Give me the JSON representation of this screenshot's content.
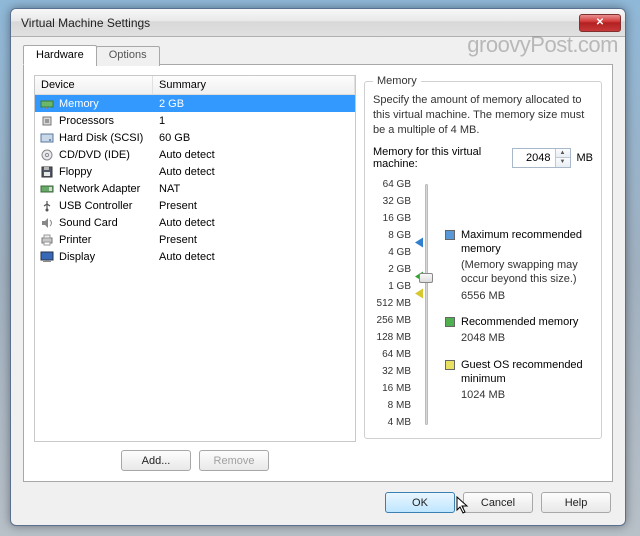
{
  "window": {
    "title": "Virtual Machine Settings"
  },
  "tabs": {
    "hardware": "Hardware",
    "options": "Options"
  },
  "list": {
    "head": {
      "device": "Device",
      "summary": "Summary"
    },
    "rows": [
      {
        "name": "Memory",
        "summary": "2 GB",
        "icon": "memory-icon",
        "selected": true
      },
      {
        "name": "Processors",
        "summary": "1",
        "icon": "cpu-icon"
      },
      {
        "name": "Hard Disk (SCSI)",
        "summary": "60 GB",
        "icon": "hdd-icon"
      },
      {
        "name": "CD/DVD (IDE)",
        "summary": "Auto detect",
        "icon": "cd-icon"
      },
      {
        "name": "Floppy",
        "summary": "Auto detect",
        "icon": "floppy-icon"
      },
      {
        "name": "Network Adapter",
        "summary": "NAT",
        "icon": "nic-icon"
      },
      {
        "name": "USB Controller",
        "summary": "Present",
        "icon": "usb-icon"
      },
      {
        "name": "Sound Card",
        "summary": "Auto detect",
        "icon": "sound-icon"
      },
      {
        "name": "Printer",
        "summary": "Present",
        "icon": "printer-icon"
      },
      {
        "name": "Display",
        "summary": "Auto detect",
        "icon": "display-icon"
      }
    ],
    "buttons": {
      "add": "Add...",
      "remove": "Remove"
    }
  },
  "memory": {
    "group_title": "Memory",
    "desc": "Specify the amount of memory allocated to this virtual machine. The memory size must be a multiple of 4 MB.",
    "label": "Memory for this virtual machine:",
    "value": "2048",
    "unit": "MB",
    "ticks": [
      "64 GB",
      "32 GB",
      "16 GB",
      "8 GB",
      "4 GB",
      "2 GB",
      "1 GB",
      "512 MB",
      "256 MB",
      "128 MB",
      "64 MB",
      "32 MB",
      "16 MB",
      "8 MB",
      "4 MB"
    ],
    "legend": {
      "max": {
        "title": "Maximum recommended memory",
        "note": "(Memory swapping may occur beyond this size.)",
        "value": "6556 MB"
      },
      "rec": {
        "title": "Recommended memory",
        "value": "2048 MB"
      },
      "min": {
        "title": "Guest OS recommended minimum",
        "value": "1024 MB"
      }
    }
  },
  "footer": {
    "ok": "OK",
    "cancel": "Cancel",
    "help": "Help"
  },
  "watermark": "groovyPost.com"
}
